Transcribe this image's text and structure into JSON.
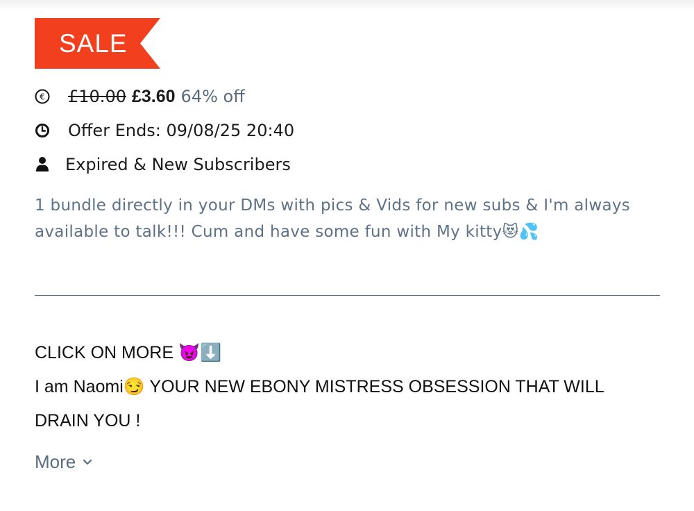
{
  "sale_badge": {
    "label": "SALE",
    "color": "#f2401f"
  },
  "offer": {
    "old_price": "£10.00",
    "new_price": "£3.60",
    "discount": "64% off",
    "ends": "Offer Ends: 09/08/25 20:40",
    "audience": "Expired & New Subscribers"
  },
  "icons": {
    "price": "currency-icon",
    "offer": "clock-icon",
    "audience": "user-icon",
    "more": "chevron-down-icon"
  },
  "description": "1 bundle directly in your DMs with pics & Vids for new subs & I'm always available to talk!!! Cum and have some fun with My kitty😻💦",
  "bio": {
    "line1": "CLICK ON MORE 😈⬇️",
    "line2": "I am Naomi😏 YOUR NEW EBONY MISTRESS OBSESSION THAT WILL",
    "line3": "DRAIN YOU !"
  },
  "more_label": "More",
  "colors": {
    "accent_text": "#5d7287",
    "sale": "#f2401f",
    "divider": "#5c6e80"
  }
}
